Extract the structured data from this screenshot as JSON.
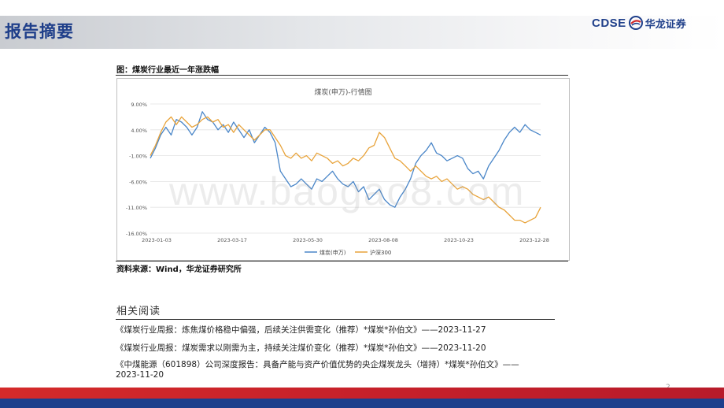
{
  "header": {
    "title": "报告摘要",
    "logo_latin": "CDSE",
    "logo_cn": "华龙证券"
  },
  "figure": {
    "caption": "图：煤炭行业最近一年涨跌幅",
    "source": "资料来源：Wind，华龙证券研究所"
  },
  "chart_data": {
    "type": "line",
    "title": "煤炭(申万)-行情图",
    "xlabel": "",
    "ylabel": "",
    "ylim": [
      -16,
      9
    ],
    "y_ticks": [
      "9.00%",
      "4.00%",
      "-1.00%",
      "-6.00%",
      "-11.00%",
      "-16.00%"
    ],
    "x_ticks": [
      "2023-01-03",
      "2023-03-17",
      "2023-05-30",
      "2023-08-08",
      "2023-10-23",
      "2023-12-28"
    ],
    "grid": true,
    "legend": "bottom",
    "series": [
      {
        "name": "煤炭(申万)",
        "color": "#4a86c8",
        "values": [
          -1.5,
          0.5,
          3.0,
          4.5,
          3.0,
          6.0,
          5.5,
          4.5,
          3.0,
          4.5,
          7.5,
          6.0,
          5.5,
          4.0,
          5.0,
          3.5,
          5.5,
          4.0,
          2.5,
          4.0,
          1.5,
          3.0,
          4.5,
          3.5,
          1.5,
          -4.0,
          -5.5,
          -7.0,
          -6.5,
          -5.5,
          -6.5,
          -7.5,
          -5.5,
          -6.0,
          -5.0,
          -4.0,
          -5.5,
          -6.5,
          -7.0,
          -6.0,
          -8.0,
          -7.0,
          -9.5,
          -8.5,
          -7.5,
          -9.5,
          -10.5,
          -11.0,
          -9.0,
          -7.5,
          -5.5,
          -2.5,
          -1.0,
          0.0,
          1.5,
          -0.5,
          -1.0,
          -2.0,
          -1.5,
          -1.0,
          -1.5,
          -3.5,
          -4.5,
          -4.0,
          -5.5,
          -3.0,
          -1.5,
          0.0,
          2.0,
          3.5,
          4.5,
          3.5,
          5.0,
          4.0,
          3.5,
          3.0
        ]
      },
      {
        "name": "沪深300",
        "color": "#e8a33a",
        "values": [
          -1.0,
          1.0,
          3.5,
          5.5,
          6.5,
          5.0,
          6.5,
          5.5,
          4.5,
          5.0,
          6.0,
          6.5,
          5.5,
          6.0,
          4.5,
          5.0,
          3.5,
          5.0,
          4.0,
          3.0,
          2.0,
          3.0,
          4.0,
          4.0,
          2.5,
          1.0,
          -1.0,
          -1.5,
          -0.5,
          -1.5,
          -1.0,
          -2.0,
          -0.5,
          -1.0,
          -1.5,
          -2.5,
          -2.0,
          -3.0,
          -2.5,
          -1.5,
          -2.0,
          -1.0,
          0.5,
          1.0,
          3.5,
          2.5,
          0.5,
          -1.5,
          -2.0,
          -3.0,
          -4.0,
          -3.0,
          -4.0,
          -5.0,
          -5.5,
          -5.0,
          -6.0,
          -5.5,
          -6.5,
          -7.5,
          -7.0,
          -7.5,
          -8.5,
          -9.0,
          -9.5,
          -9.0,
          -10.0,
          -11.0,
          -11.5,
          -12.5,
          -13.5,
          -13.5,
          -14.0,
          -13.5,
          -13.0,
          -11.0
        ]
      }
    ]
  },
  "watermark": "www.baogao8.com",
  "related": {
    "title": "相关阅读",
    "items": [
      "《煤炭行业周报：炼焦煤价格稳中偏强，后续关注供需变化（推荐）*煤炭*孙伯文》——2023-11-27",
      "《煤炭行业周报：煤炭需求以刚需为主，持续关注煤价变化（推荐）*煤炭*孙伯文》——2023-11-20",
      "《中煤能源（601898）公司深度报告：具备产能与资产价值优势的央企煤炭龙头（增持）*煤炭*孙伯文》——",
      "2023-11-20"
    ]
  },
  "page": {
    "number": "2"
  }
}
